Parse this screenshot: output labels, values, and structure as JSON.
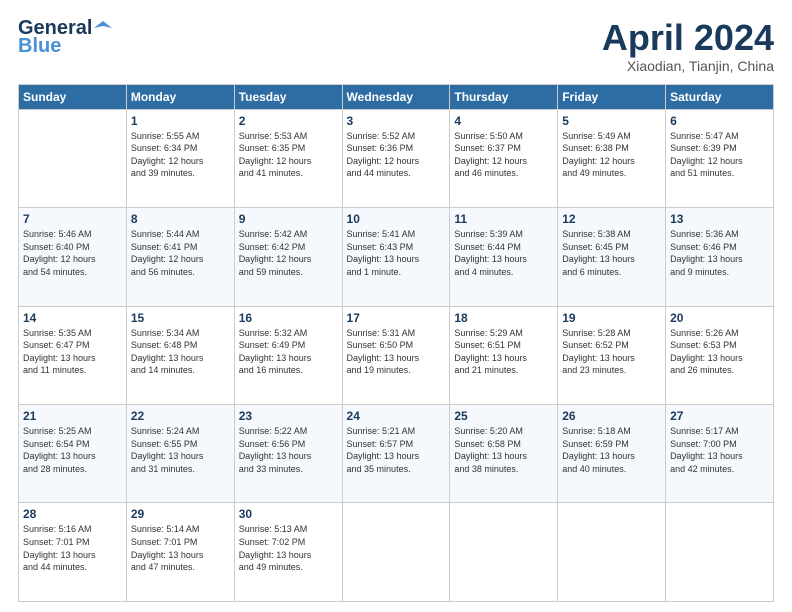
{
  "header": {
    "logo_line1": "General",
    "logo_line2": "Blue",
    "month_title": "April 2024",
    "location": "Xiaodian, Tianjin, China"
  },
  "days_of_week": [
    "Sunday",
    "Monday",
    "Tuesday",
    "Wednesday",
    "Thursday",
    "Friday",
    "Saturday"
  ],
  "weeks": [
    [
      {
        "day": "",
        "info": ""
      },
      {
        "day": "1",
        "info": "Sunrise: 5:55 AM\nSunset: 6:34 PM\nDaylight: 12 hours\nand 39 minutes."
      },
      {
        "day": "2",
        "info": "Sunrise: 5:53 AM\nSunset: 6:35 PM\nDaylight: 12 hours\nand 41 minutes."
      },
      {
        "day": "3",
        "info": "Sunrise: 5:52 AM\nSunset: 6:36 PM\nDaylight: 12 hours\nand 44 minutes."
      },
      {
        "day": "4",
        "info": "Sunrise: 5:50 AM\nSunset: 6:37 PM\nDaylight: 12 hours\nand 46 minutes."
      },
      {
        "day": "5",
        "info": "Sunrise: 5:49 AM\nSunset: 6:38 PM\nDaylight: 12 hours\nand 49 minutes."
      },
      {
        "day": "6",
        "info": "Sunrise: 5:47 AM\nSunset: 6:39 PM\nDaylight: 12 hours\nand 51 minutes."
      }
    ],
    [
      {
        "day": "7",
        "info": "Sunrise: 5:46 AM\nSunset: 6:40 PM\nDaylight: 12 hours\nand 54 minutes."
      },
      {
        "day": "8",
        "info": "Sunrise: 5:44 AM\nSunset: 6:41 PM\nDaylight: 12 hours\nand 56 minutes."
      },
      {
        "day": "9",
        "info": "Sunrise: 5:42 AM\nSunset: 6:42 PM\nDaylight: 12 hours\nand 59 minutes."
      },
      {
        "day": "10",
        "info": "Sunrise: 5:41 AM\nSunset: 6:43 PM\nDaylight: 13 hours\nand 1 minute."
      },
      {
        "day": "11",
        "info": "Sunrise: 5:39 AM\nSunset: 6:44 PM\nDaylight: 13 hours\nand 4 minutes."
      },
      {
        "day": "12",
        "info": "Sunrise: 5:38 AM\nSunset: 6:45 PM\nDaylight: 13 hours\nand 6 minutes."
      },
      {
        "day": "13",
        "info": "Sunrise: 5:36 AM\nSunset: 6:46 PM\nDaylight: 13 hours\nand 9 minutes."
      }
    ],
    [
      {
        "day": "14",
        "info": "Sunrise: 5:35 AM\nSunset: 6:47 PM\nDaylight: 13 hours\nand 11 minutes."
      },
      {
        "day": "15",
        "info": "Sunrise: 5:34 AM\nSunset: 6:48 PM\nDaylight: 13 hours\nand 14 minutes."
      },
      {
        "day": "16",
        "info": "Sunrise: 5:32 AM\nSunset: 6:49 PM\nDaylight: 13 hours\nand 16 minutes."
      },
      {
        "day": "17",
        "info": "Sunrise: 5:31 AM\nSunset: 6:50 PM\nDaylight: 13 hours\nand 19 minutes."
      },
      {
        "day": "18",
        "info": "Sunrise: 5:29 AM\nSunset: 6:51 PM\nDaylight: 13 hours\nand 21 minutes."
      },
      {
        "day": "19",
        "info": "Sunrise: 5:28 AM\nSunset: 6:52 PM\nDaylight: 13 hours\nand 23 minutes."
      },
      {
        "day": "20",
        "info": "Sunrise: 5:26 AM\nSunset: 6:53 PM\nDaylight: 13 hours\nand 26 minutes."
      }
    ],
    [
      {
        "day": "21",
        "info": "Sunrise: 5:25 AM\nSunset: 6:54 PM\nDaylight: 13 hours\nand 28 minutes."
      },
      {
        "day": "22",
        "info": "Sunrise: 5:24 AM\nSunset: 6:55 PM\nDaylight: 13 hours\nand 31 minutes."
      },
      {
        "day": "23",
        "info": "Sunrise: 5:22 AM\nSunset: 6:56 PM\nDaylight: 13 hours\nand 33 minutes."
      },
      {
        "day": "24",
        "info": "Sunrise: 5:21 AM\nSunset: 6:57 PM\nDaylight: 13 hours\nand 35 minutes."
      },
      {
        "day": "25",
        "info": "Sunrise: 5:20 AM\nSunset: 6:58 PM\nDaylight: 13 hours\nand 38 minutes."
      },
      {
        "day": "26",
        "info": "Sunrise: 5:18 AM\nSunset: 6:59 PM\nDaylight: 13 hours\nand 40 minutes."
      },
      {
        "day": "27",
        "info": "Sunrise: 5:17 AM\nSunset: 7:00 PM\nDaylight: 13 hours\nand 42 minutes."
      }
    ],
    [
      {
        "day": "28",
        "info": "Sunrise: 5:16 AM\nSunset: 7:01 PM\nDaylight: 13 hours\nand 44 minutes."
      },
      {
        "day": "29",
        "info": "Sunrise: 5:14 AM\nSunset: 7:01 PM\nDaylight: 13 hours\nand 47 minutes."
      },
      {
        "day": "30",
        "info": "Sunrise: 5:13 AM\nSunset: 7:02 PM\nDaylight: 13 hours\nand 49 minutes."
      },
      {
        "day": "",
        "info": ""
      },
      {
        "day": "",
        "info": ""
      },
      {
        "day": "",
        "info": ""
      },
      {
        "day": "",
        "info": ""
      }
    ]
  ]
}
